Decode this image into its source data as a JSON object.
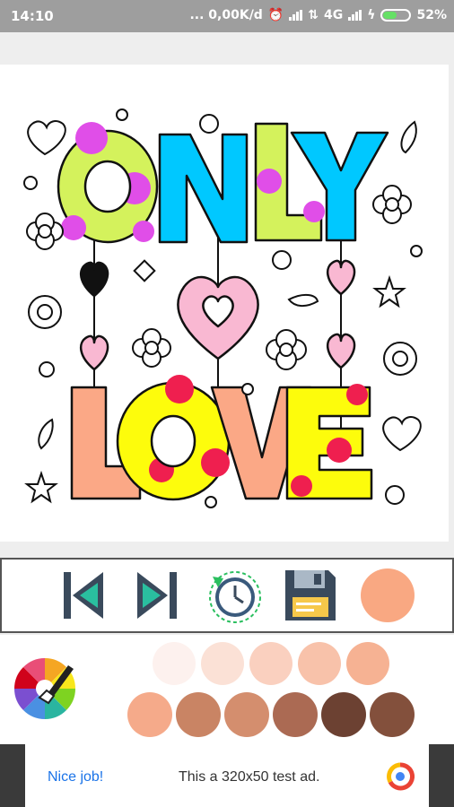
{
  "status_bar": {
    "time": "14:10",
    "network_speed": "... 0,00K/d",
    "network_type": "4G",
    "battery_percent": "52%",
    "battery_level": 0.52
  },
  "coloring_page": {
    "title_words": [
      "ONLY",
      "LOVE"
    ],
    "colors": {
      "green": "#d4f25c",
      "cyan": "#00c8ff",
      "pink": "#f9b8d2",
      "magenta": "#e04ee8",
      "peach": "#fba886",
      "yellow": "#fdfc0c",
      "red": "#ef1f4f"
    }
  },
  "toolbar": {
    "tools": [
      {
        "name": "undo-button",
        "icon": "skip-back-icon"
      },
      {
        "name": "redo-button",
        "icon": "skip-forward-icon"
      },
      {
        "name": "history-button",
        "icon": "clock-history-icon"
      },
      {
        "name": "save-button",
        "icon": "floppy-disk-icon"
      },
      {
        "name": "current-color-button",
        "icon": "color-circle",
        "color": "#f9a882"
      }
    ]
  },
  "palette": {
    "picker_icon": "color-wheel-brush-icon",
    "row1": [
      "#fdf1ee",
      "#fbe1d6",
      "#fad0bf",
      "#f8c2aa",
      "#f6b293"
    ],
    "row2": [
      "#f5aa8a",
      "#c98464",
      "#d48e6e",
      "#ab6a53",
      "#6c4132",
      "#83503c"
    ]
  },
  "ad": {
    "cta": "Nice job!",
    "message": "This a 320x50 test ad."
  }
}
